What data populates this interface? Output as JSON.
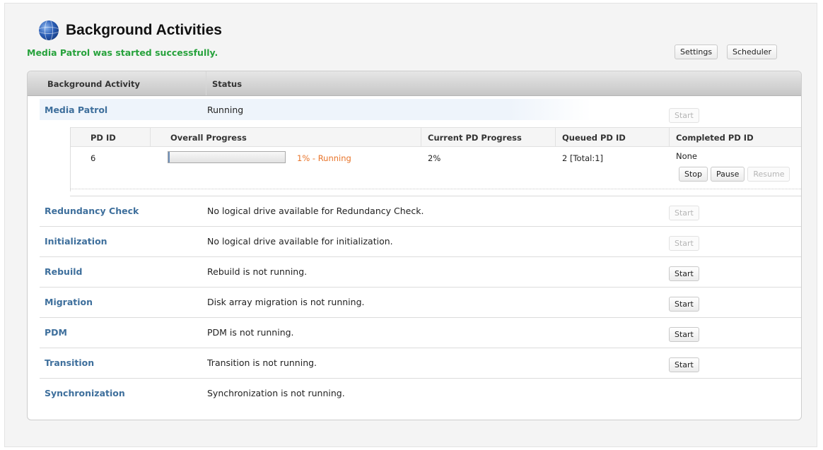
{
  "header": {
    "title": "Background Activities",
    "icon": "globe-icon",
    "status_message": "Media Patrol was started successfully.",
    "status_color": "#27a23c",
    "settings_label": "Settings",
    "scheduler_label": "Scheduler"
  },
  "table": {
    "col_activity": "Background Activity",
    "col_status": "Status"
  },
  "media_patrol": {
    "name": "Media Patrol",
    "status": "Running",
    "start_label": "Start",
    "start_enabled": false,
    "pd_table": {
      "headers": [
        "PD ID",
        "Overall Progress",
        "Current PD Progress",
        "Queued PD ID",
        "Completed PD ID"
      ],
      "row": {
        "pd_id": "6",
        "overall_progress_fraction": 0.01,
        "overall_progress_text": "1% - Running",
        "current_pd_progress": "2%",
        "queued_pd_id": "2 [Total:1]",
        "completed_pd_id": "None"
      },
      "actions": {
        "stop": "Stop",
        "pause": "Pause",
        "resume": "Resume"
      }
    }
  },
  "activities": [
    {
      "name": "Redundancy Check",
      "status": "No logical drive available for Redundancy Check.",
      "start_label": "Start",
      "start_enabled": false
    },
    {
      "name": "Initialization",
      "status": "No logical drive available for initialization.",
      "start_label": "Start",
      "start_enabled": false
    },
    {
      "name": "Rebuild",
      "status": "Rebuild is not running.",
      "start_label": "Start",
      "start_enabled": true
    },
    {
      "name": "Migration",
      "status": "Disk array migration is not running.",
      "start_label": "Start",
      "start_enabled": true
    },
    {
      "name": "PDM",
      "status": "PDM is not running.",
      "start_label": "Start",
      "start_enabled": true
    },
    {
      "name": "Transition",
      "status": "Transition is not running.",
      "start_label": "Start",
      "start_enabled": true
    },
    {
      "name": "Synchronization",
      "status": "Synchronization is not running.",
      "start_label": "",
      "start_enabled": false
    }
  ],
  "colors": {
    "link": "#3e6f9c",
    "progress_text": "#e8742a",
    "progress_fill": "#6e8fb8"
  }
}
